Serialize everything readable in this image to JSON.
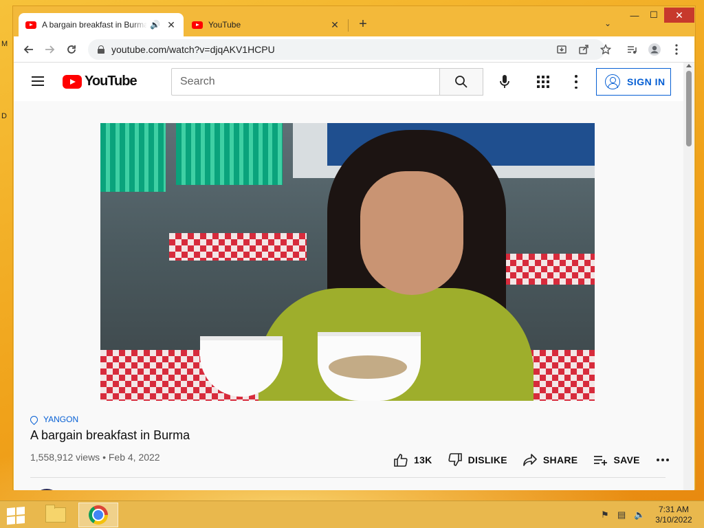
{
  "desktop": {
    "fragments": [
      "M",
      "D"
    ]
  },
  "browser": {
    "tabs": [
      {
        "title": "A bargain breakfast in Burma",
        "active": true,
        "audio": true
      },
      {
        "title": "YouTube",
        "active": false,
        "audio": false
      }
    ],
    "url": "youtube.com/watch?v=djqAKV1HCPU",
    "window_controls": {
      "minimize": "—",
      "maximize": "☐",
      "close": "✕"
    }
  },
  "youtube": {
    "logo_text": "YouTube",
    "search_placeholder": "Search",
    "sign_in_label": "SIGN IN"
  },
  "video": {
    "location": "YANGON",
    "title": "A bargain breakfast in Burma",
    "meta": "1,558,912 views • Feb 4, 2022",
    "likes": "13K",
    "dislike_label": "DISLIKE",
    "share_label": "SHARE",
    "save_label": "SAVE"
  },
  "taskbar": {
    "time": "7:31 AM",
    "date": "3/10/2022"
  },
  "colors": {
    "youtube_red": "#ff0000",
    "link_blue": "#065fd4",
    "window_frame": "#f3b93a",
    "taskbar": "#e9b84d"
  }
}
